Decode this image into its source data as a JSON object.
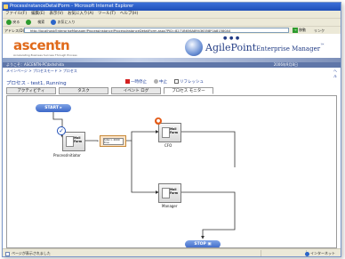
{
  "window": {
    "title": "ProcessInstanceDetailForm - Microsoft Internet Explorer"
  },
  "menu": [
    "ファイル(F)",
    "編集(E)",
    "表示(V)",
    "お気に入り(A)",
    "ツール(T)",
    "ヘルプ(H)"
  ],
  "toolbar": {
    "back": "戻る",
    "search": "検索",
    "favorites": "お気に入り"
  },
  "address": {
    "label": "アドレス(D)",
    "url": "http://localhost/EnterpriseManager/ProcessInstance/ProcessInstanceDetailForm.aspx?PID=8271B656A89436358F0A81580A4",
    "go": "移動",
    "links": "リンク"
  },
  "header": {
    "brand": "ascentn",
    "tagline": "Accelerating Business Success Through Process",
    "product_name": "AgilePoint",
    "product_sub": "Enterprise Manager",
    "trademark": "™"
  },
  "userbar": {
    "text": "ようこそ：ASCENTN-PC\\bshshida",
    "date": "2006年9月8日"
  },
  "breadcrumb": {
    "items": [
      "メインページ",
      "プロセスモード",
      "プロセス"
    ],
    "help": "ヘル"
  },
  "process": {
    "title": "プロセス - test1, Running",
    "suspend": "一時停止",
    "cancel": "中止",
    "refresh": "リフレッシュ"
  },
  "tabs": [
    "アクティビティ",
    "タスク",
    "イベント ログ",
    "プロセス モニター"
  ],
  "diagram": {
    "start": "START",
    "stop": "STOP",
    "task_text": "Mail Form",
    "tasks": [
      "ProcessInitiator",
      "CFO",
      "Manager"
    ],
    "decision": "total > 2000 true"
  },
  "status": {
    "text": "ページが表示されました",
    "zone": "インターネット"
  }
}
